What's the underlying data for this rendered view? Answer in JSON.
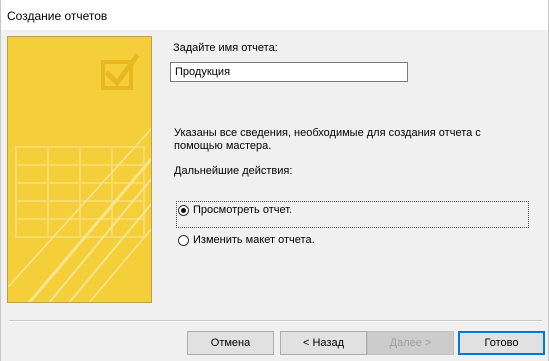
{
  "window": {
    "title": "Создание отчетов"
  },
  "form": {
    "name_label": "Задайте имя отчета:",
    "name_value": "Продукция",
    "info_text": "Указаны все сведения, необходимые для создания отчета с помощью мастера.",
    "next_actions_label": "Дальнейшие действия:",
    "options": [
      {
        "label": "Просмотреть отчет.",
        "checked": true
      },
      {
        "label": "Изменить макет отчета.",
        "checked": false
      }
    ]
  },
  "buttons": {
    "cancel": "Отмена",
    "back": "< Назад",
    "next": "Далее >",
    "finish": "Готово"
  },
  "colors": {
    "banner": "#f4cf3a",
    "accent": "#0078d7"
  }
}
